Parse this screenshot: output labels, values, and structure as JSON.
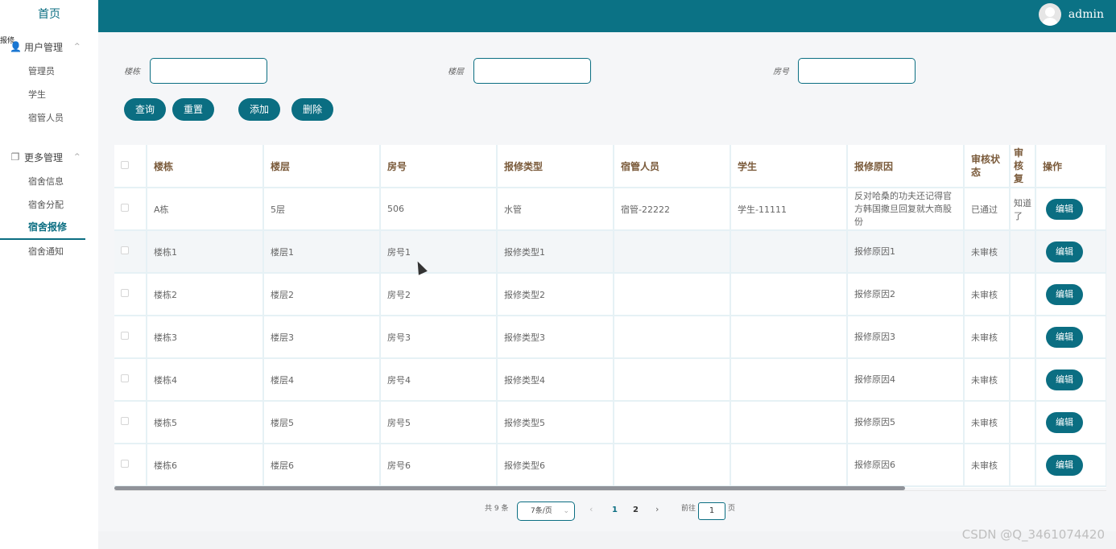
{
  "sidebar": {
    "home": "首页",
    "edge_label": "报修",
    "groups": [
      {
        "label": "用户管理",
        "items": [
          "管理员",
          "学生",
          "宿管人员"
        ]
      },
      {
        "label": "更多管理",
        "items": [
          "宿舍信息",
          "宿舍分配",
          "宿舍报修",
          "宿舍通知"
        ]
      }
    ],
    "active_item": "宿舍报修"
  },
  "header": {
    "username": "admin"
  },
  "search": {
    "building_label": "楼栋",
    "floor_label": "楼层",
    "room_label": "房号",
    "building_value": "",
    "floor_value": "",
    "room_value": ""
  },
  "toolbar": {
    "query": "查询",
    "reset": "重置",
    "add": "添加",
    "delete": "删除"
  },
  "table": {
    "headers": [
      "楼栋",
      "楼层",
      "房号",
      "报修类型",
      "宿管人员",
      "学生",
      "报修原因",
      "审核状态",
      "审核回复",
      "操作"
    ],
    "header_display": {
      "audit_reply": "审核复"
    },
    "edit_label": "编辑",
    "rows": [
      [
        "A栋",
        "5层",
        "506",
        "水管",
        "宿管-22222",
        "学生-11111",
        "反对哈桑的功夫还记得官方韩国撒旦回复就大商股份",
        "已通过",
        "知道了"
      ],
      [
        "楼栋1",
        "楼层1",
        "房号1",
        "报修类型1",
        "",
        "",
        "报修原因1",
        "未审核",
        ""
      ],
      [
        "楼栋2",
        "楼层2",
        "房号2",
        "报修类型2",
        "",
        "",
        "报修原因2",
        "未审核",
        ""
      ],
      [
        "楼栋3",
        "楼层3",
        "房号3",
        "报修类型3",
        "",
        "",
        "报修原因3",
        "未审核",
        ""
      ],
      [
        "楼栋4",
        "楼层4",
        "房号4",
        "报修类型4",
        "",
        "",
        "报修原因4",
        "未审核",
        ""
      ],
      [
        "楼栋5",
        "楼层5",
        "房号5",
        "报修类型5",
        "",
        "",
        "报修原因5",
        "未审核",
        ""
      ],
      [
        "楼栋6",
        "楼层6",
        "房号6",
        "报修类型6",
        "",
        "",
        "报修原因6",
        "未审核",
        ""
      ]
    ]
  },
  "pagination": {
    "total": "共 9 条",
    "page_size": "7条/页",
    "pages": [
      "1",
      "2"
    ],
    "goto_label": "前往",
    "goto_value": "1",
    "goto_suffix": "页"
  },
  "watermark": "CSDN @Q_3461074420",
  "colors": {
    "primary": "#0b6e82",
    "header": "#0b7285"
  }
}
